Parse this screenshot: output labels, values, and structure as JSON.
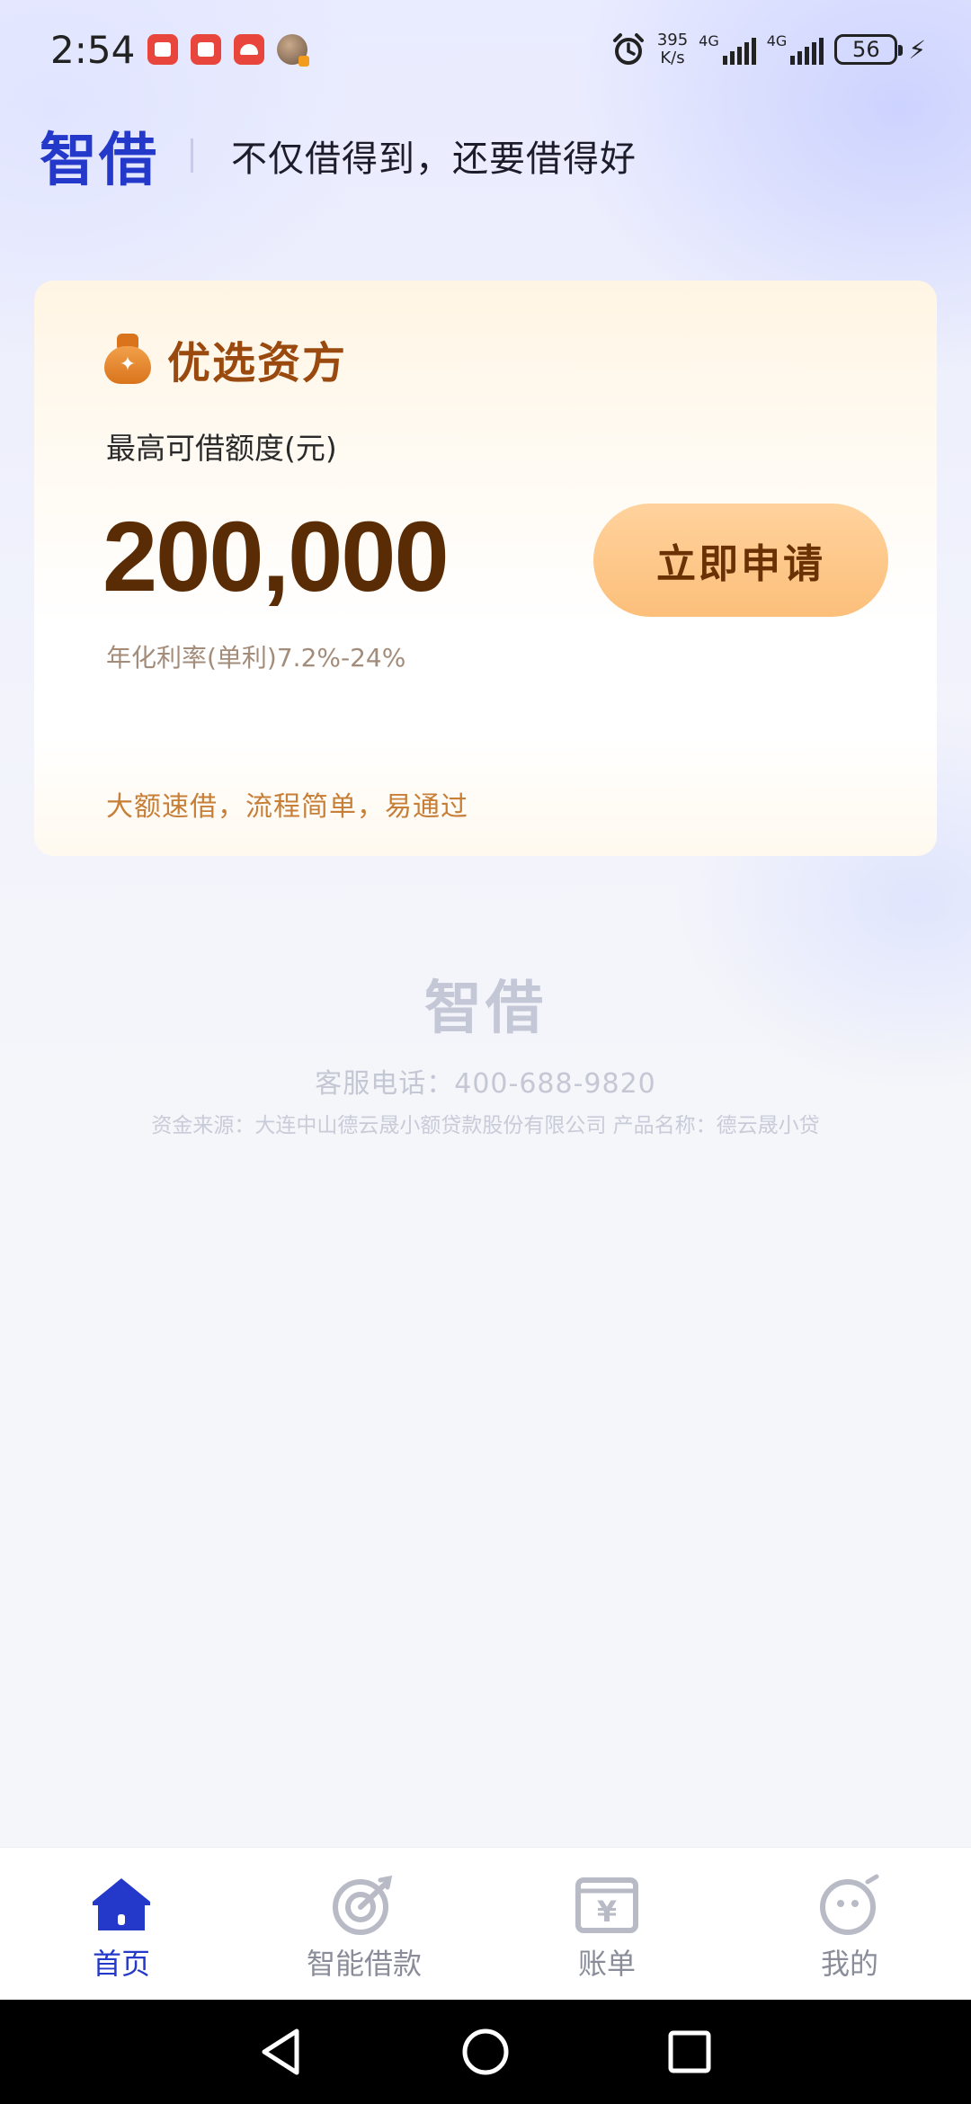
{
  "status_bar": {
    "time": "2:54",
    "speed_value": "395",
    "speed_unit": "K/s",
    "net1": "4G",
    "net2": "4G",
    "battery": "56"
  },
  "header": {
    "logo": "智借",
    "slogan": "不仅借得到，还要借得好"
  },
  "card": {
    "title": "优选资方",
    "limit_label": "最高可借额度(元)",
    "amount": "200,000",
    "apply_label": "立即申请",
    "rate": "年化利率(单利)7.2%-24%",
    "footer": "大额速借，流程简单，易通过"
  },
  "brand_footer": {
    "logo": "智借",
    "phone": "客服电话：400-688-9820",
    "source": "资金来源：大连中山德云晟小额贷款股份有限公司 产品名称：德云晟小贷"
  },
  "bottom_nav": {
    "items": [
      {
        "label": "首页",
        "icon": "home-icon",
        "active": true
      },
      {
        "label": "智能借款",
        "icon": "target-icon",
        "active": false
      },
      {
        "label": "账单",
        "icon": "bill-icon",
        "active": false
      },
      {
        "label": "我的",
        "icon": "profile-icon",
        "active": false
      }
    ]
  },
  "colors": {
    "brand_blue": "#2439c9",
    "card_title": "#9a4a0e",
    "amount": "#5a2c06",
    "button_bg": "#fcbf7a",
    "footer_orange": "#c77e36"
  }
}
